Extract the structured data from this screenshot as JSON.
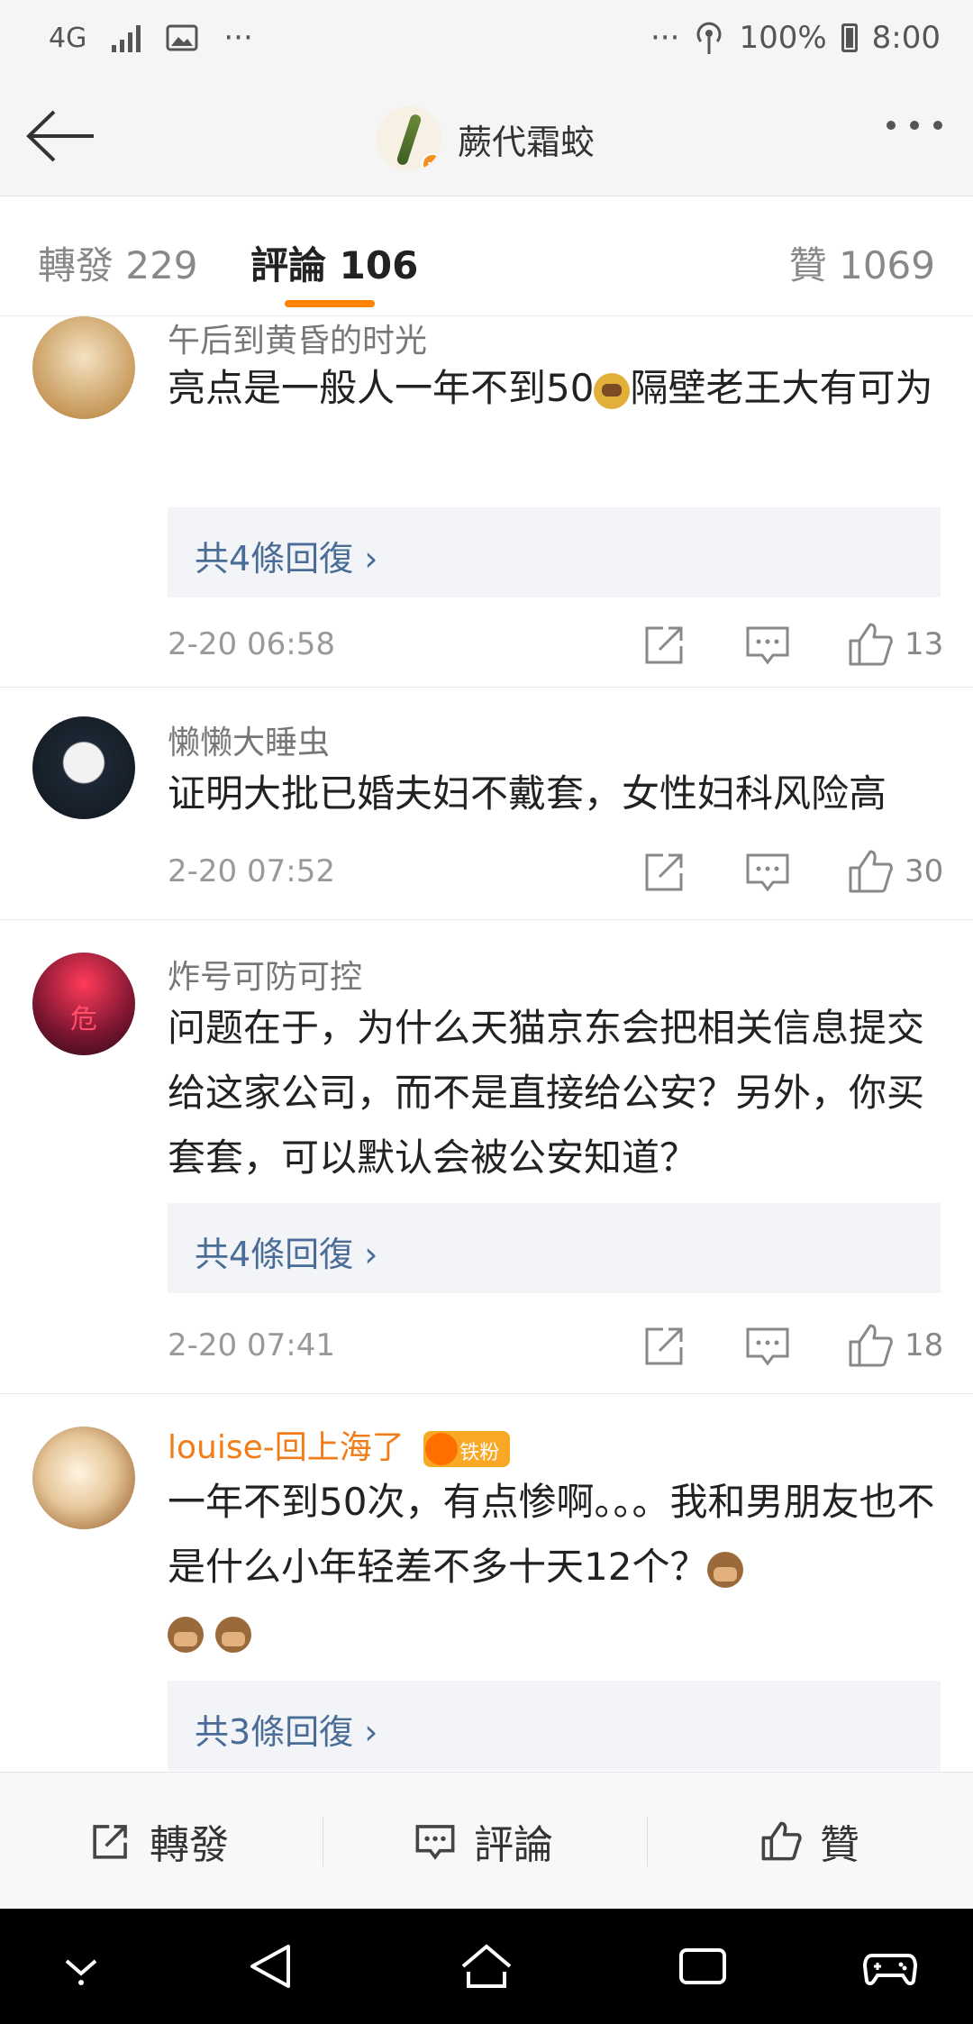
{
  "status_bar": {
    "network": "4G",
    "battery": "100%",
    "time": "8:00",
    "more_left": "···",
    "more_right": "···"
  },
  "header": {
    "title": "蕨代霜蛟",
    "verified_badge": "v"
  },
  "tabs": [
    {
      "label": "轉發 229"
    },
    {
      "label": "評論 106"
    },
    {
      "label": "贊 1069"
    }
  ],
  "comments": [
    {
      "name": "午后到黄昏的时光",
      "text_before_emoji": "亮点是一般人一年不到50",
      "text_after_emoji": "隔壁老王大有可为",
      "reply": "共4條回復 ›",
      "date": "2-20 06:58",
      "likes": "13"
    },
    {
      "name": "懒懒大睡虫",
      "text": "证明大批已婚夫妇不戴套，女性妇科风险高",
      "date": "2-20 07:52",
      "likes": "30"
    },
    {
      "name": "炸号可防可控",
      "text": "问题在于，为什么天猫京东会把相关信息提交给这家公司，而不是直接给公安？另外，你买套套，可以默认会被公安知道？",
      "reply": "共4條回復 ›",
      "date": "2-20 07:41",
      "likes": "18",
      "avatar_glyph": "危"
    },
    {
      "name": "louise-回上海了",
      "badge": "铁粉",
      "text": "一年不到50次，有点惨啊。。。我和男朋友也不是什么小年轻差不多十天12个？",
      "reply": "共3條回復 ›"
    }
  ],
  "bottom_bar": {
    "repost": "轉發",
    "comment": "評論",
    "like": "贊"
  },
  "colors": {
    "accent": "#ff8200",
    "link": "#4a6d98",
    "fan_name": "#f07d1a"
  }
}
